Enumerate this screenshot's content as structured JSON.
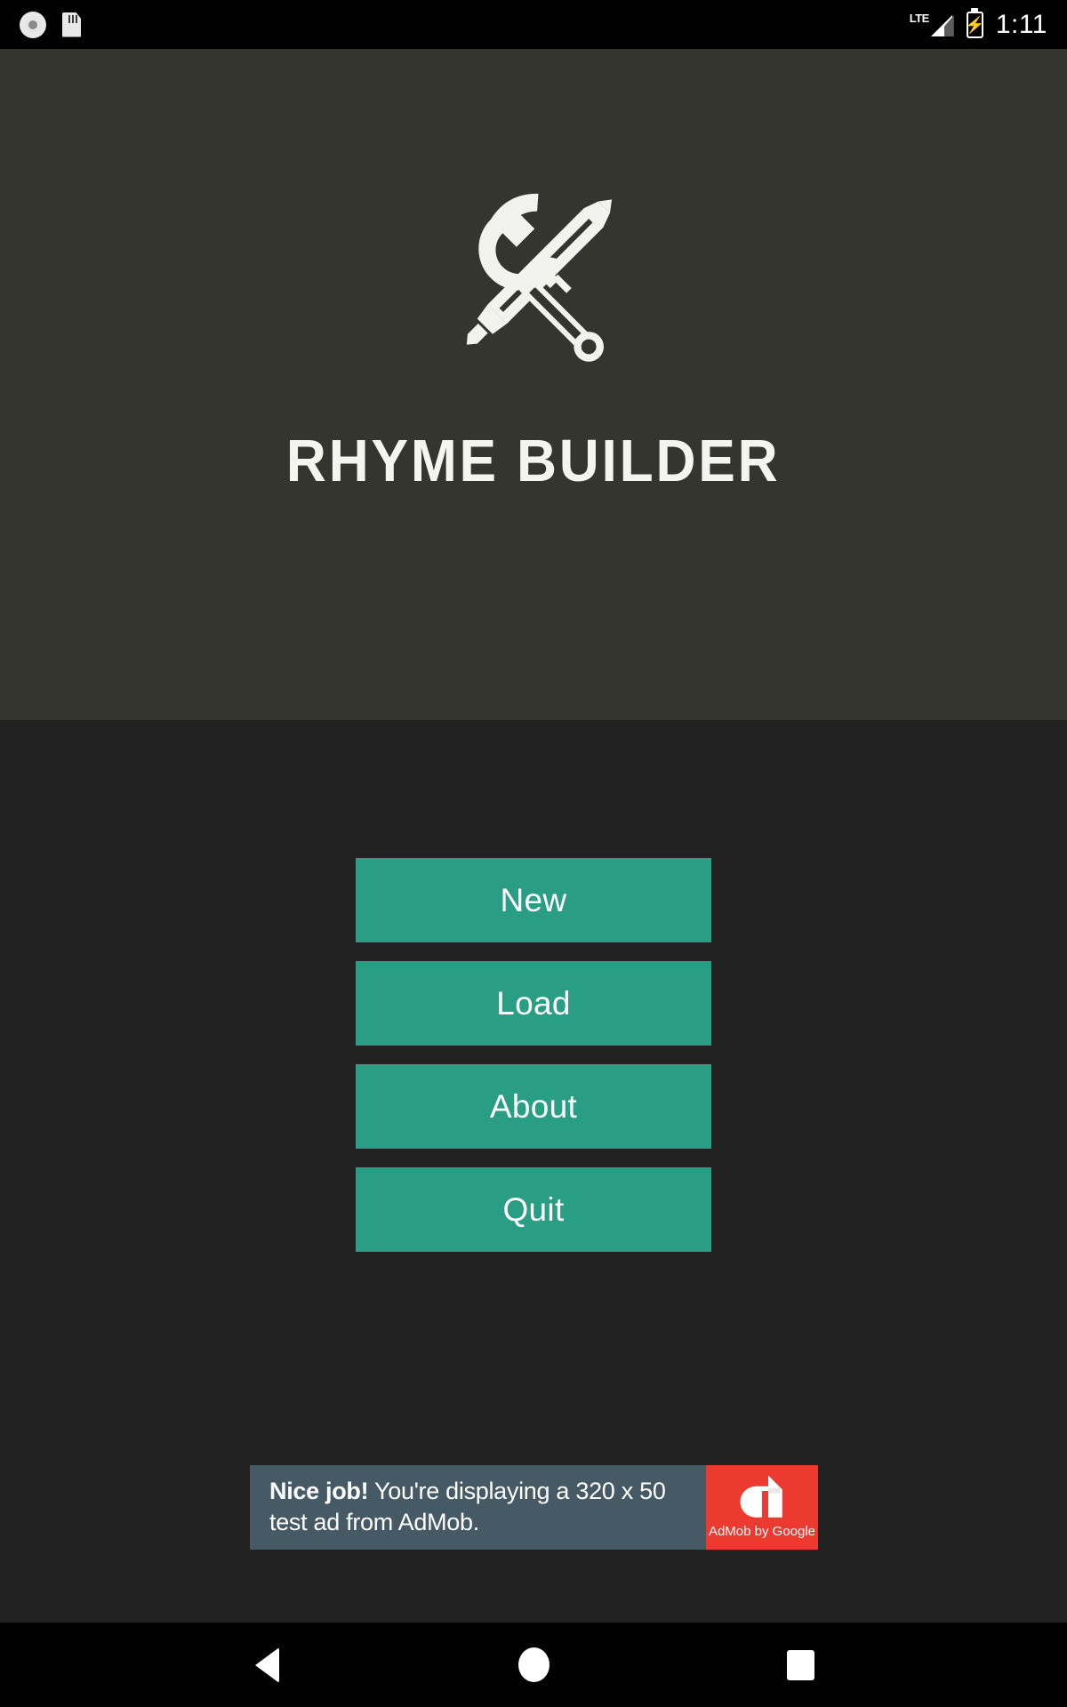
{
  "status_bar": {
    "icons_left": [
      {
        "name": "screen-record-icon",
        "glyph": "record"
      },
      {
        "name": "sd-card-icon",
        "glyph": "sdcard"
      }
    ],
    "network_label": "LTE",
    "signal_icon": "signal-bars-icon",
    "battery_icon": "battery-charging-icon",
    "time": "1:11"
  },
  "header": {
    "logo_name": "wrench-and-pen-logo",
    "title": "RHYME BUILDER",
    "background_color": "#35352f"
  },
  "menu": {
    "buttons": [
      {
        "label": "New",
        "name": "new-button"
      },
      {
        "label": "Load",
        "name": "load-button"
      },
      {
        "label": "About",
        "name": "about-button"
      },
      {
        "label": "Quit",
        "name": "quit-button"
      }
    ],
    "accent_color": "#2a9d85",
    "background_color": "#212121"
  },
  "ad": {
    "headline": "Nice job!",
    "body": " You're displaying a 320 x 50 test ad from AdMob.",
    "brand": "AdMob by Google",
    "brand_color": "#ec3a31",
    "panel_color": "#455a64",
    "size_label": "320 x 50"
  },
  "nav_bar": {
    "buttons": [
      {
        "name": "nav-back-button",
        "glyph": "triangle-left"
      },
      {
        "name": "nav-home-button",
        "glyph": "circle"
      },
      {
        "name": "nav-recents-button",
        "glyph": "square"
      }
    ]
  }
}
